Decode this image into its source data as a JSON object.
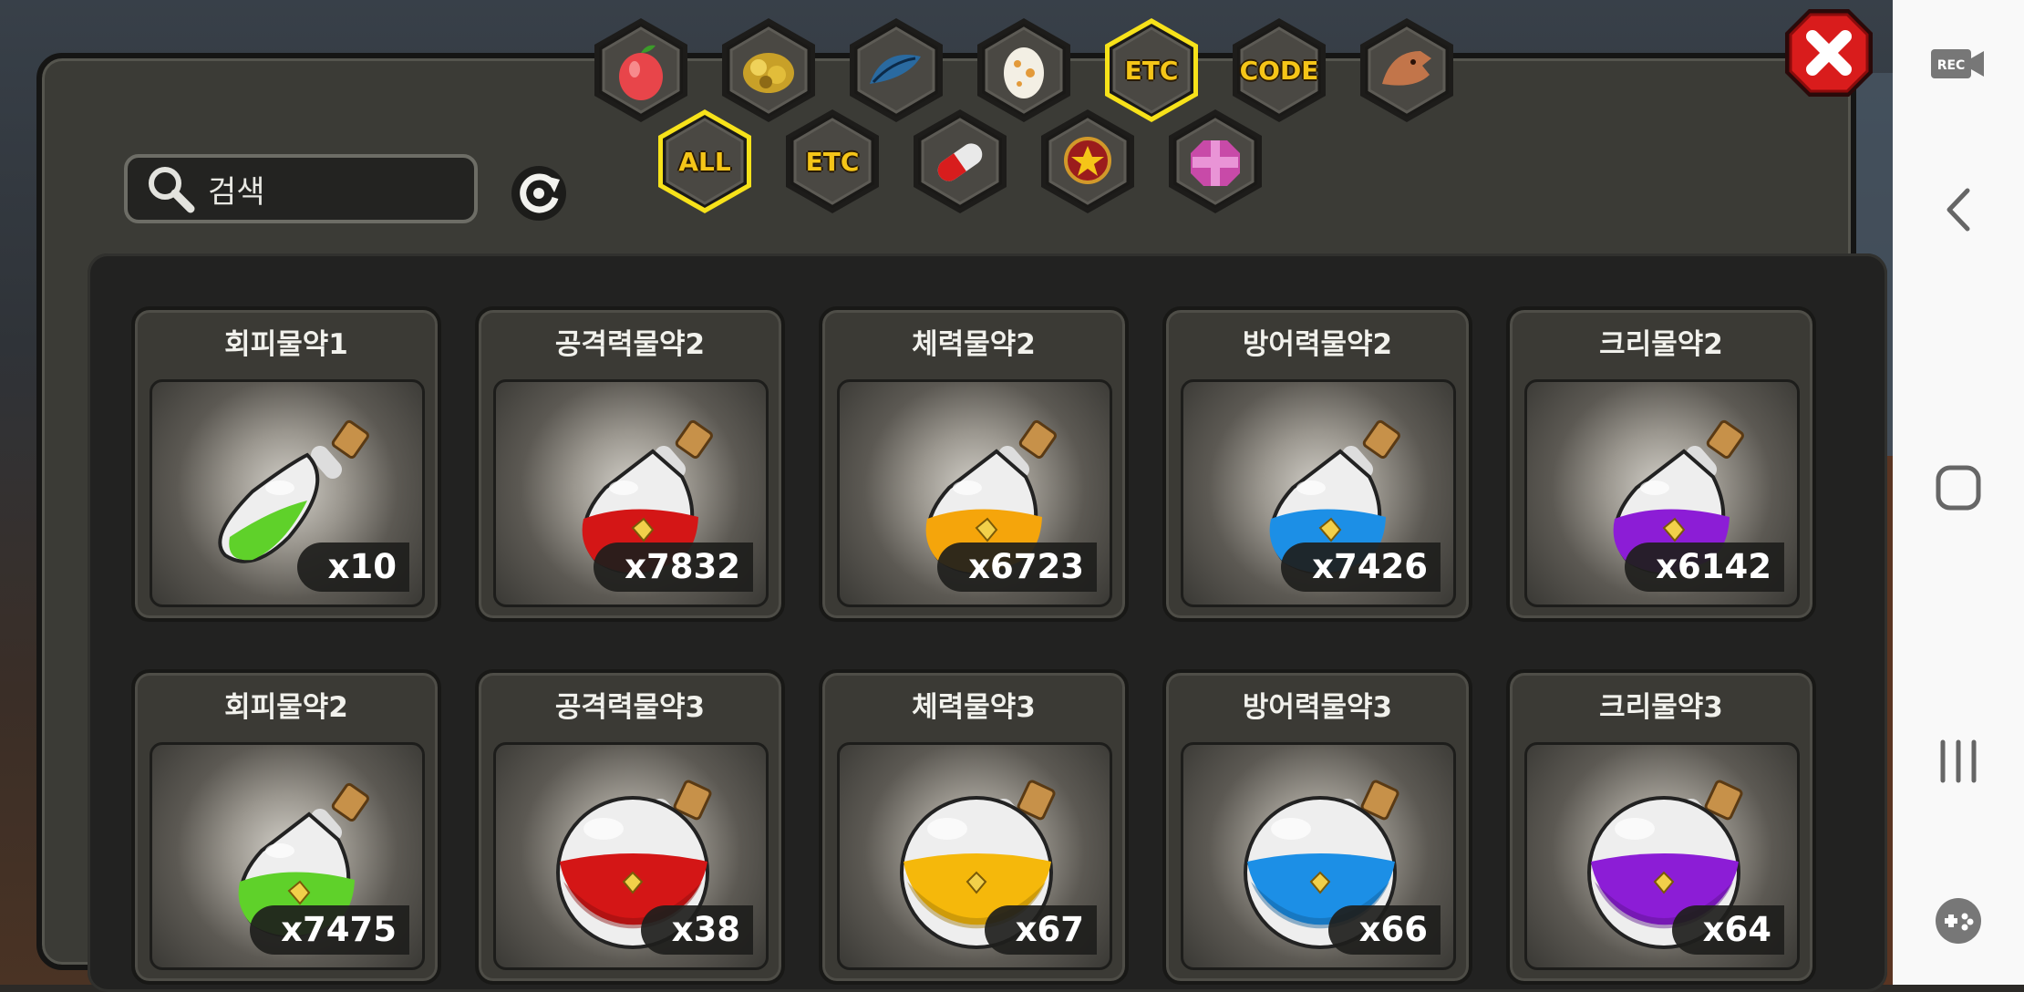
{
  "search": {
    "placeholder": "검색",
    "icon": "magnifier-icon"
  },
  "refresh": {
    "icon": "refresh-icon"
  },
  "close": {
    "icon": "close-x-icon",
    "color": "#d91c1c"
  },
  "category_tabs_row1": [
    {
      "id": "fruit",
      "icon": "red-fruit-icon",
      "label": "",
      "selected": false
    },
    {
      "id": "ore",
      "icon": "gold-ore-icon",
      "label": "",
      "selected": false
    },
    {
      "id": "feather",
      "icon": "blue-feather-icon",
      "label": "",
      "selected": false
    },
    {
      "id": "egg",
      "icon": "spotted-egg-icon",
      "label": "",
      "selected": false
    },
    {
      "id": "etc1",
      "icon": "",
      "label": "ETC",
      "selected": true
    },
    {
      "id": "code",
      "icon": "",
      "label": "CODE",
      "selected": false
    },
    {
      "id": "dragon",
      "icon": "dragon-head-icon",
      "label": "",
      "selected": false
    }
  ],
  "category_tabs_row2": [
    {
      "id": "all",
      "icon": "",
      "label": "ALL",
      "selected": true
    },
    {
      "id": "etc2",
      "icon": "",
      "label": "ETC",
      "selected": false
    },
    {
      "id": "pill",
      "icon": "red-pill-icon",
      "label": "",
      "selected": false
    },
    {
      "id": "badge",
      "icon": "star-badge-icon",
      "label": "",
      "selected": false
    },
    {
      "id": "box",
      "icon": "gift-box-icon",
      "label": "",
      "selected": false
    }
  ],
  "items": [
    {
      "name": "회피물약1",
      "count": "x10",
      "color": "#5fd12a",
      "shape": "flask-slim"
    },
    {
      "name": "공격력물약2",
      "count": "x7832",
      "color": "#d41616",
      "shape": "flask"
    },
    {
      "name": "체력물약2",
      "count": "x6723",
      "color": "#f5a50b",
      "shape": "flask"
    },
    {
      "name": "방어력물약2",
      "count": "x7426",
      "color": "#1c8fe6",
      "shape": "flask"
    },
    {
      "name": "크리물약2",
      "count": "x6142",
      "color": "#8c1dd6",
      "shape": "flask"
    },
    {
      "name": "회피물약2",
      "count": "x7475",
      "color": "#5fd12a",
      "shape": "flask"
    },
    {
      "name": "공격력물약3",
      "count": "x38",
      "color": "#d41616",
      "shape": "round"
    },
    {
      "name": "체력물약3",
      "count": "x67",
      "color": "#f5b80b",
      "shape": "round"
    },
    {
      "name": "방어력물약3",
      "count": "x66",
      "color": "#1c8fe6",
      "shape": "round"
    },
    {
      "name": "크리물약3",
      "count": "x64",
      "color": "#8c1dd6",
      "shape": "round"
    }
  ],
  "android_nav": {
    "rec_label": "REC",
    "icons": [
      "rec-camera-icon",
      "back-chevron-icon",
      "home-square-icon",
      "recents-lines-icon",
      "gamepad-icon"
    ]
  }
}
